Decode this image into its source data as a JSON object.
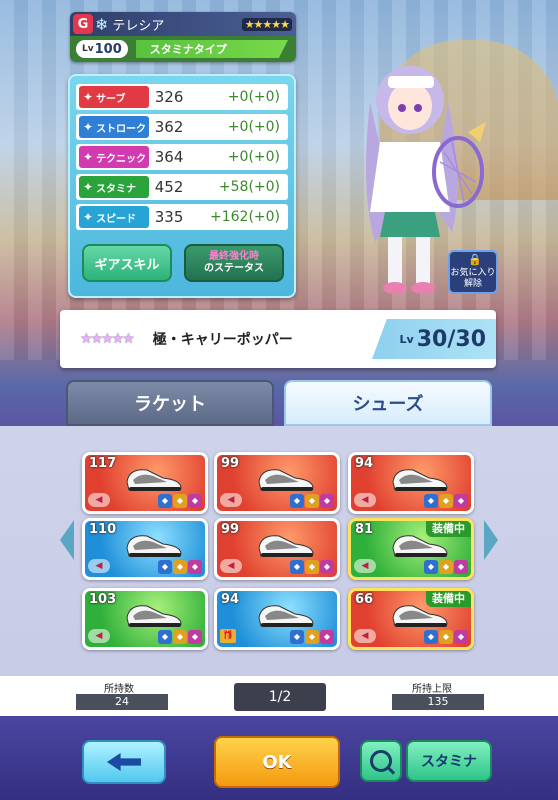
{
  "character": {
    "rarity": "G",
    "name": "テレシア",
    "stars": "★★★★★",
    "lv_label": "Lv",
    "level": "100",
    "type": "スタミナタイプ"
  },
  "stats": [
    {
      "label": "サーブ",
      "value": "326",
      "bonus": "+0",
      "extra": "(+0)",
      "color": "#e23a44"
    },
    {
      "label": "ストローク",
      "value": "362",
      "bonus": "+0",
      "extra": "(+0)",
      "color": "#2f7fd6"
    },
    {
      "label": "テクニック",
      "value": "364",
      "bonus": "+0",
      "extra": "(+0)",
      "color": "#d23ab0"
    },
    {
      "label": "スタミナ",
      "value": "452",
      "bonus": "+58",
      "extra": "(+0)",
      "color": "#2aa33a"
    },
    {
      "label": "スピード",
      "value": "335",
      "bonus": "+162",
      "extra": "(+0)",
      "color": "#26a4d6"
    }
  ],
  "buttons": {
    "gear_skill": "ギアスキル",
    "status_line1": "最終強化時",
    "status_line2": "のステータス",
    "favorite_line1": "お気に入り",
    "favorite_line2": "解除",
    "ok": "OK",
    "sort": "スタミナ"
  },
  "gear": {
    "stars": "★★★★★",
    "name": "極・キャリーポッパー",
    "lv_label": "Lv",
    "level": "30/30"
  },
  "tabs": {
    "racket": "ラケット",
    "shoes": "シューズ"
  },
  "cards": [
    {
      "power": "117",
      "color": "red",
      "equipped": false
    },
    {
      "power": "99",
      "color": "red",
      "equipped": false
    },
    {
      "power": "94",
      "color": "red",
      "equipped": false
    },
    {
      "power": "110",
      "color": "blue",
      "equipped": false
    },
    {
      "power": "99",
      "color": "red",
      "equipped": false
    },
    {
      "power": "81",
      "color": "green",
      "equipped": true
    },
    {
      "power": "103",
      "color": "green",
      "equipped": false
    },
    {
      "power": "94",
      "color": "blue",
      "equipped": false
    },
    {
      "power": "66",
      "color": "red",
      "equipped": true
    }
  ],
  "equipped_label": "装備中",
  "footer": {
    "owned_label": "所持数",
    "owned": "24",
    "page": "1/2",
    "limit_label": "所持上限",
    "limit": "135"
  }
}
